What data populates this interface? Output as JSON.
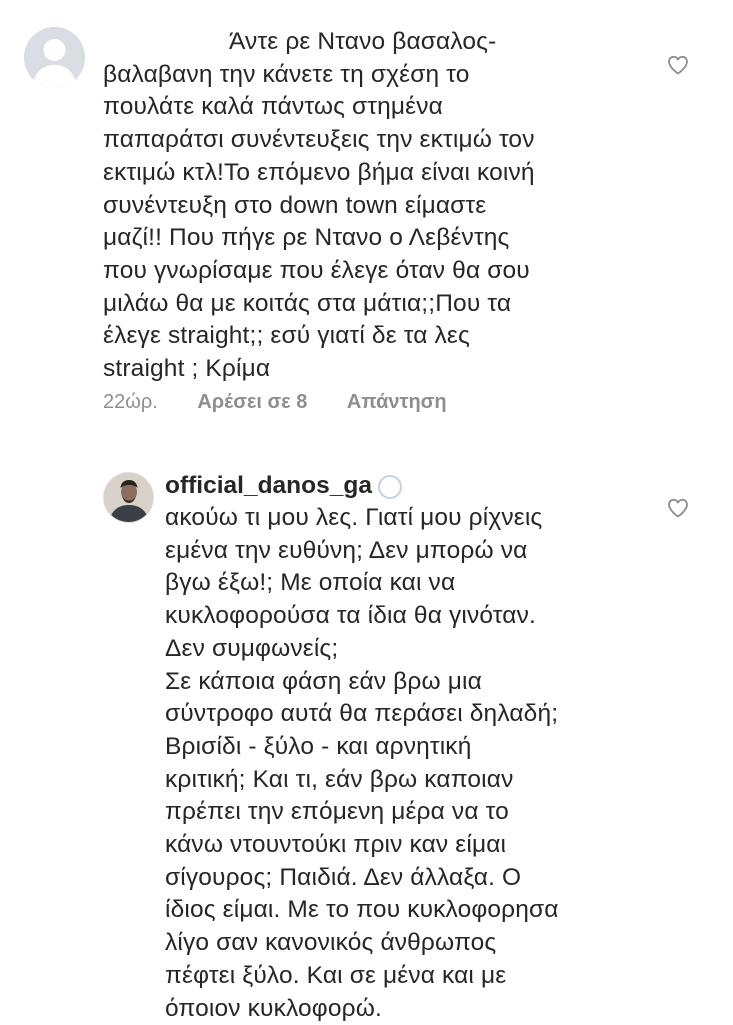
{
  "comments": [
    {
      "avatar": "default-avatar",
      "lines": [
        "Άντε ρε Ντανο βασαλος-",
        "βαλαβανη την κάνετε τη σχέση το",
        "πουλάτε καλά πάντως στημένα",
        "παπαράτσι συνέντευξεις την εκτιμώ τον",
        "εκτιμώ κτλ!Το επόμενο βήμα είναι κοινή",
        "συνέντευξη στο down town είμαστε",
        "μαζί!! Που πήγε ρε Ντανο ο Λεβέντης",
        "που γνωρίσαμε που έλεγε όταν θα σου",
        "μιλάω θα με κοιτάς στα μάτια;;Που τα",
        "έλεγε straight;; εσύ γιατί δε τα λες",
        "straight ; Κρίμα"
      ],
      "time": "22ώρ.",
      "likes": "Αρέσει σε 8",
      "reply": "Απάντηση",
      "like_icon": "heart-outline-icon"
    },
    {
      "username": "official_danos_ga",
      "avatar": "profile-photo",
      "lines": [
        "ακούω τι μου λες. Γιατί μου ρίχνεις",
        "εμένα την ευθύνη; Δεν μπορώ να",
        "βγω έξω!; Με οποία και να",
        "κυκλοφορούσα τα ίδια θα γινόταν.",
        "Δεν συμφωνείς;",
        "Σε κάποια φάση εάν βρω μια",
        "σύντροφο αυτά θα περάσει δηλαδή;",
        "Βρισίδι - ξύλο - και αρνητική",
        "κριτική; Και τι, εάν βρω καποιαν",
        "πρέπει την επόμενη μέρα να το",
        "κάνω ντουντούκι πριν καν είμαι",
        "σίγουρος; Παιδιά. Δεν άλλαξα. Ο",
        "ίδιος είμαι. Με το που κυκλοφορησα",
        "λίγο σαν κανονικός άνθρωπος",
        "πέφτει ξύλο. Και σε μένα και με",
        "όποιον κυκλοφορώ."
      ],
      "like_icon": "heart-outline-icon"
    }
  ]
}
